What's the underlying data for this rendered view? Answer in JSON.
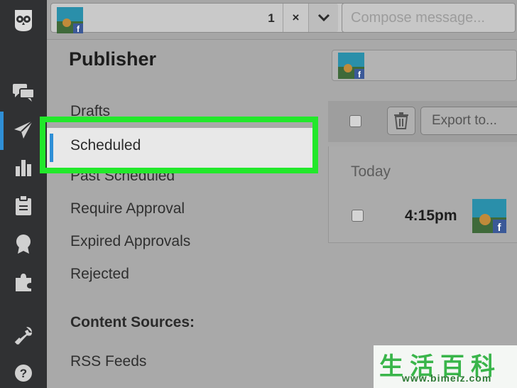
{
  "app": {
    "accent": "#2f8fd6",
    "highlight": "#22e82b"
  },
  "rail": {
    "icons": [
      "owl-logo-icon",
      "chat-bubbles-icon",
      "paper-plane-icon",
      "bar-chart-icon",
      "clipboard-icon",
      "badge-icon",
      "puzzle-icon",
      "wrench-icon",
      "help-icon"
    ]
  },
  "topbar": {
    "profile_count": "1",
    "clear_label": "×",
    "compose_placeholder": "Compose message..."
  },
  "publisher": {
    "title": "Publisher",
    "items": [
      {
        "label": "Drafts"
      },
      {
        "label": "Scheduled",
        "selected": true
      },
      {
        "label": "Past Scheduled"
      },
      {
        "label": "Require Approval"
      },
      {
        "label": "Expired Approvals"
      },
      {
        "label": "Rejected"
      }
    ],
    "content_sources_label": "Content Sources:",
    "content_sources": [
      {
        "label": "RSS Feeds"
      }
    ]
  },
  "stream": {
    "export_label": "Export to...",
    "group_label": "Today",
    "posts": [
      {
        "time": "4:15pm"
      }
    ]
  },
  "watermark": {
    "chars": "生活百科",
    "url": "www.bimeiz.com"
  }
}
